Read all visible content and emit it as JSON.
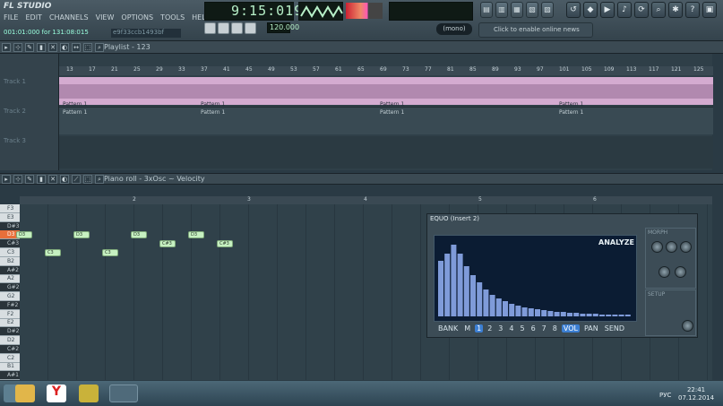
{
  "app": {
    "logo": "FL STUDIO"
  },
  "menu": [
    "FILE",
    "EDIT",
    "CHANNELS",
    "VIEW",
    "OPTIONS",
    "TOOLS",
    "HELP"
  ],
  "status": {
    "song_pos": "001:01:000 for 131:08:015",
    "hint_id": "e9f33ccb1493bf"
  },
  "transport": {
    "time": "9:15:019",
    "bpm": "120.000",
    "pattern_label": "PAT",
    "song_label": "SONG",
    "mono_mode": "(mono)"
  },
  "news": {
    "text": "Click to enable online news"
  },
  "playlist": {
    "title": "Playlist - 123",
    "tracks": [
      "Track 1",
      "Track 2",
      "Track 3"
    ],
    "pattern_label": "Pattern 1"
  },
  "ruler": {
    "marks": [
      "13",
      "17",
      "21",
      "25",
      "29",
      "33",
      "37",
      "41",
      "45",
      "49",
      "53",
      "57",
      "61",
      "65",
      "69",
      "73",
      "77",
      "81",
      "85",
      "89",
      "93",
      "97",
      "101",
      "105",
      "109",
      "113",
      "117",
      "121",
      "125"
    ]
  },
  "piano_roll": {
    "title": "Piano roll - 3xOsc",
    "mode": "Velocity",
    "bars": [
      "2",
      "3",
      "4",
      "5",
      "6"
    ],
    "keys": [
      "F3",
      "E3",
      "D#3",
      "D3",
      "C#3",
      "C3",
      "B2",
      "A#2",
      "A2",
      "G#2",
      "G2",
      "F#2",
      "F2",
      "E2",
      "D#2",
      "D2",
      "C#2",
      "C2",
      "B1",
      "A#1"
    ],
    "notes": [
      "D3",
      "C3",
      "D3",
      "C3",
      "D3",
      "C#3",
      "D3",
      "C#3"
    ]
  },
  "eq": {
    "title": "EQUO (Insert 2)",
    "analyze": "ANALYZE",
    "bank": "BANK",
    "m": "M",
    "bands": [
      "1",
      "2",
      "3",
      "4",
      "5",
      "6",
      "7",
      "8"
    ],
    "modes": [
      "VOL",
      "PAN",
      "SEND"
    ],
    "morph": "MORPH",
    "setup": "SETUP",
    "knobs": [
      "SHIFT",
      "EQ",
      "MORPH",
      "SMOOTH",
      "EQ"
    ]
  },
  "taskbar": {
    "language": "РУС",
    "time": "22:41",
    "date": "07.12.2014"
  }
}
